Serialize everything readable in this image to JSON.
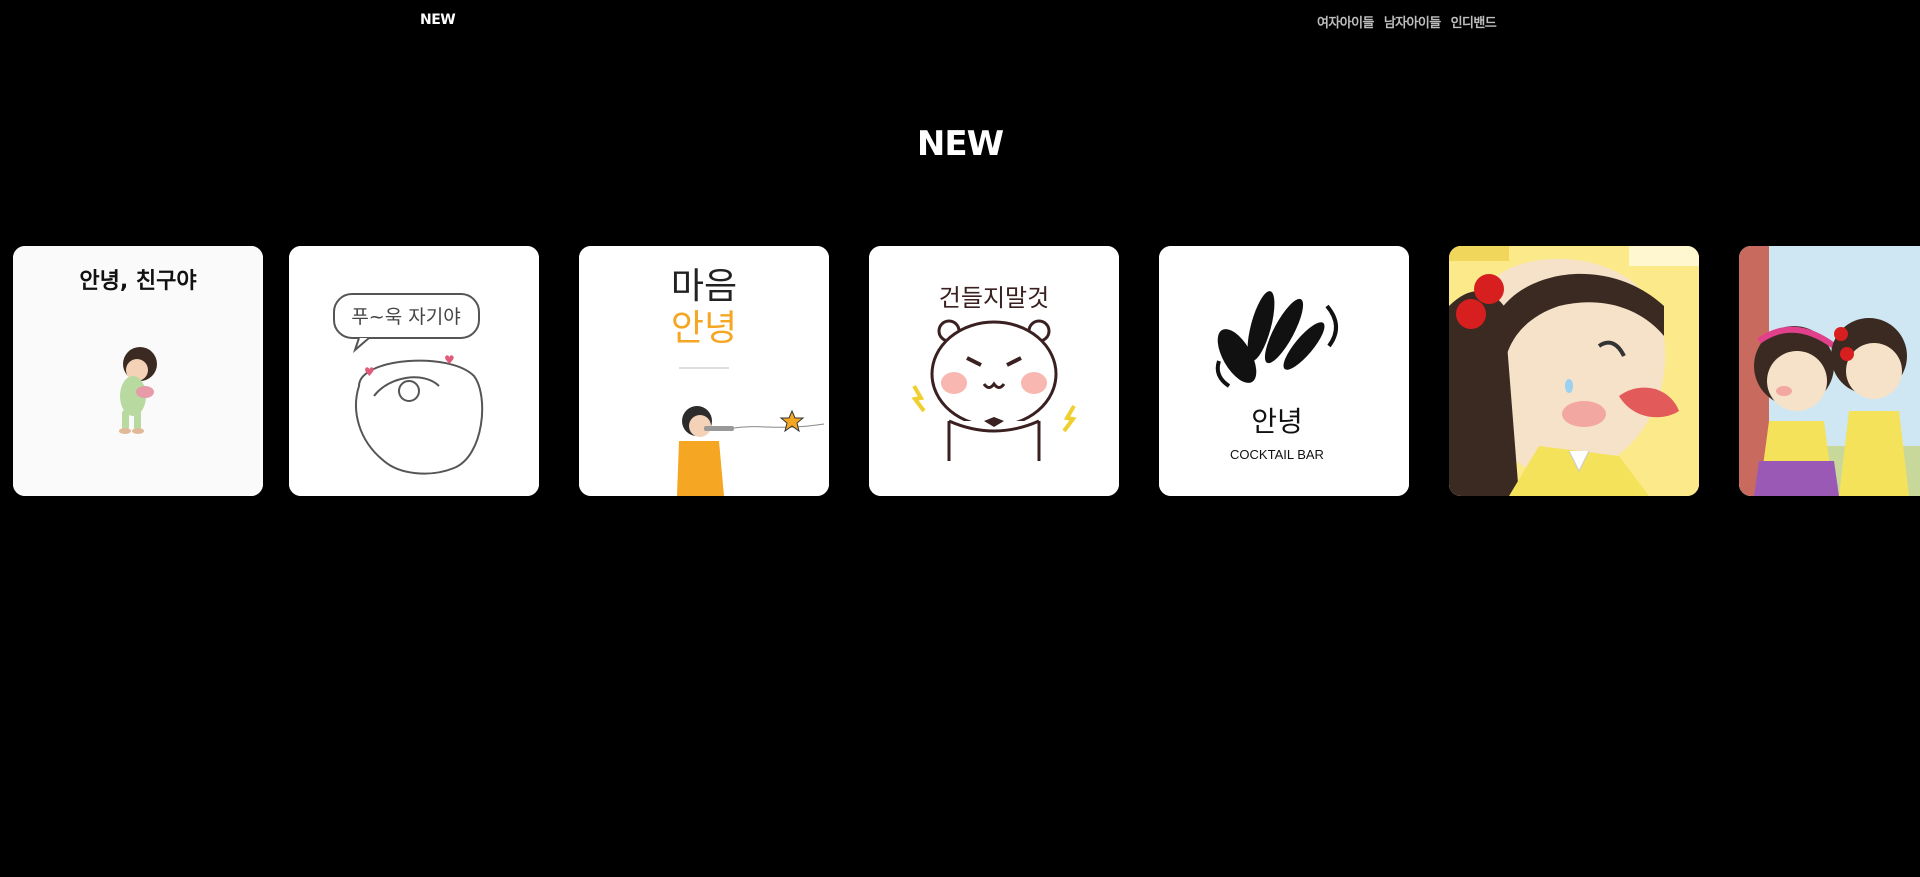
{
  "header": {
    "logo": "NEW",
    "nav": [
      "여자아이들",
      "남자아이들",
      "인디밴드"
    ]
  },
  "section": {
    "title": "NEW"
  },
  "cards": [
    {
      "text": "안녕, 친구야",
      "small": ""
    },
    {
      "text": "푸~욱 자기야",
      "small": ""
    },
    {
      "text": "마음",
      "text2": "안녕",
      "small": ""
    },
    {
      "text": "건들지말것",
      "small": ""
    },
    {
      "text": "안녕",
      "small": "COCKTAIL BAR"
    },
    {
      "text": "",
      "small": ""
    },
    {
      "text": "",
      "small": ""
    }
  ],
  "colors": {
    "background": "#000000",
    "nav_text": "#bdbdbd",
    "orange": "#f5a623",
    "pink_cheek": "#f8b7b0",
    "cartoon_yellow": "#fbe98a"
  }
}
